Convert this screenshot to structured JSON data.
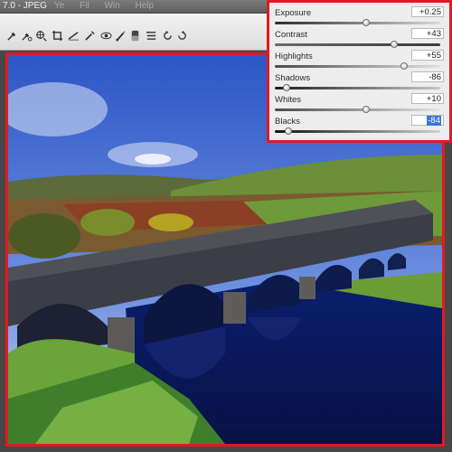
{
  "window": {
    "title": "7.0  -  JPEG",
    "menus": [
      "Ye",
      "Fil",
      "Win",
      "Help"
    ]
  },
  "toolbar": {
    "tools": [
      {
        "name": "eyedropper-icon"
      },
      {
        "name": "color-sampler-icon"
      },
      {
        "name": "target-adjust-icon"
      },
      {
        "name": "crop-icon"
      },
      {
        "name": "straighten-icon"
      },
      {
        "name": "spot-removal-icon"
      },
      {
        "name": "red-eye-icon"
      },
      {
        "name": "adjustment-brush-icon"
      },
      {
        "name": "graduated-filter-icon"
      },
      {
        "name": "preferences-icon"
      },
      {
        "name": "rotate-left-icon"
      },
      {
        "name": "rotate-right-icon"
      }
    ]
  },
  "adjustments": [
    {
      "label": "Exposure",
      "value": "+0.25",
      "level": 0.55
    },
    {
      "label": "Contrast",
      "value": "+43",
      "level": 0.72
    },
    {
      "label": "Highlights",
      "value": "+55",
      "level": 0.78
    },
    {
      "label": "Shadows",
      "value": "-86",
      "level": 0.07
    },
    {
      "label": "Whites",
      "value": "+10",
      "level": 0.55
    },
    {
      "label": "Blacks",
      "value": "-84",
      "level": 0.08,
      "selected": true
    }
  ],
  "colors": {
    "highlight_border": "#e01a22",
    "selection": "#3875d7"
  }
}
